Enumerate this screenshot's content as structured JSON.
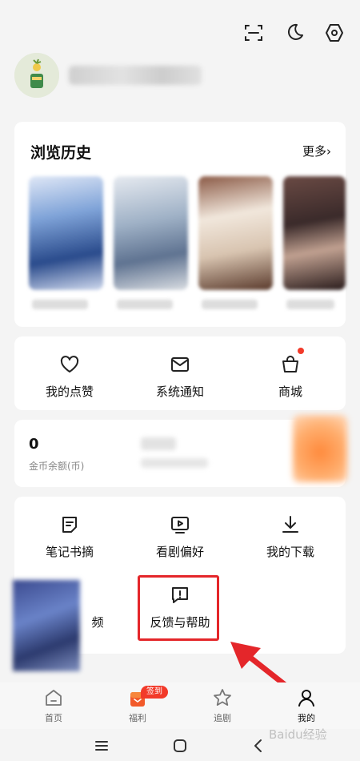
{
  "header": {
    "icons": [
      "scan-icon",
      "moon-icon",
      "settings-icon"
    ]
  },
  "history": {
    "title": "浏览历史",
    "more_label": "更多›"
  },
  "quick_actions": [
    {
      "label": "我的点赞",
      "icon": "heart-icon"
    },
    {
      "label": "系统通知",
      "icon": "mail-icon"
    },
    {
      "label": "商城",
      "icon": "shopping-bag-icon",
      "has_dot": true
    }
  ],
  "coins": {
    "value": "0",
    "label": "金币余额(币)"
  },
  "tools": [
    {
      "label": "笔记书摘",
      "icon": "note-icon"
    },
    {
      "label": "看剧偏好",
      "icon": "play-screen-icon"
    },
    {
      "label": "我的下载",
      "icon": "download-icon"
    },
    {
      "label": "频",
      "icon": ""
    },
    {
      "label": "反馈与帮助",
      "icon": "feedback-icon"
    }
  ],
  "tabbar": [
    {
      "label": "首页",
      "icon": "home-icon"
    },
    {
      "label": "福利",
      "icon": "gift-icon",
      "badge": "签到"
    },
    {
      "label": "追剧",
      "icon": "star-icon"
    },
    {
      "label": "我的",
      "icon": "person-icon",
      "active": true
    }
  ],
  "watermark": "Baidu经验",
  "colors": {
    "accent_red": "#f23a2a",
    "highlight": "#e4262a"
  }
}
